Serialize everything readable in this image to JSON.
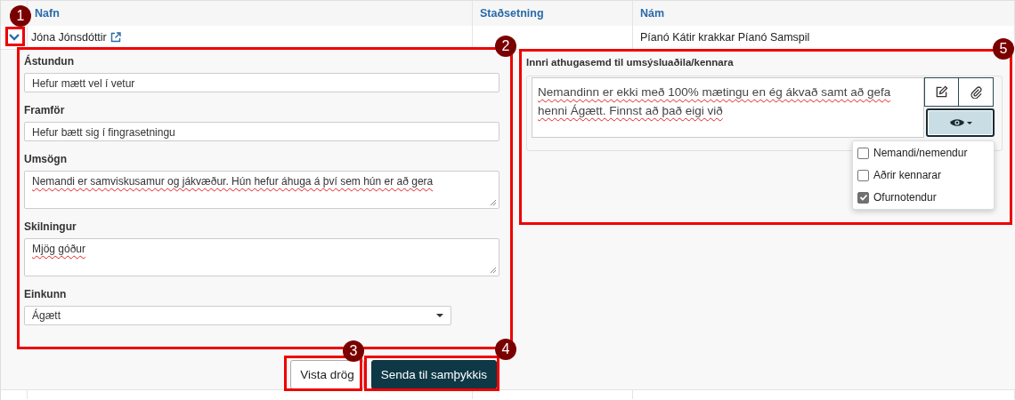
{
  "table": {
    "columns": [
      "Nafn",
      "Staðsetning",
      "Nám"
    ],
    "rows": [
      {
        "expanded": true,
        "name": "Jóna Jónsdóttir",
        "location": "",
        "course": "Píanó Kátir krakkar Píanó Samspil"
      }
    ]
  },
  "form": {
    "fields": [
      {
        "kind": "input",
        "label": "Ástundun",
        "value": "Hefur mætt vel í vetur"
      },
      {
        "kind": "input",
        "label": "Framför",
        "value": "Hefur bætt sig í fingrasetningu"
      },
      {
        "kind": "textarea",
        "label": "Umsögn",
        "value": "Nemandi er samviskusamur og jákvæður. Hún hefur áhuga á því sem hún er að gera"
      },
      {
        "kind": "textarea",
        "label": "Skilningur",
        "value": "Mjög góður"
      },
      {
        "kind": "select",
        "label": "Einkunn",
        "value": "Ágætt"
      }
    ],
    "buttons": [
      {
        "kind": "secondary",
        "label": "Vista drög"
      },
      {
        "kind": "primary",
        "label": "Senda til samþykkis"
      }
    ]
  },
  "internal_note": {
    "label": "Innri athugasemd til umsýsluaðila/kennara",
    "value": "Nemandinn er ekki með 100% mætingu en ég ákvað samt að gefa henni Ágætt. Finnst að það eigi við",
    "visibility_menu": {
      "expanded": true,
      "options": [
        {
          "label": "Nemandi/nemendur",
          "checked": false
        },
        {
          "label": "Aðrir kennarar",
          "checked": false
        },
        {
          "label": "Ofurnotendur",
          "checked": true
        }
      ]
    }
  },
  "annotations": [
    {
      "number": "1"
    },
    {
      "number": "2"
    },
    {
      "number": "3"
    },
    {
      "number": "4"
    },
    {
      "number": "5"
    }
  ]
}
